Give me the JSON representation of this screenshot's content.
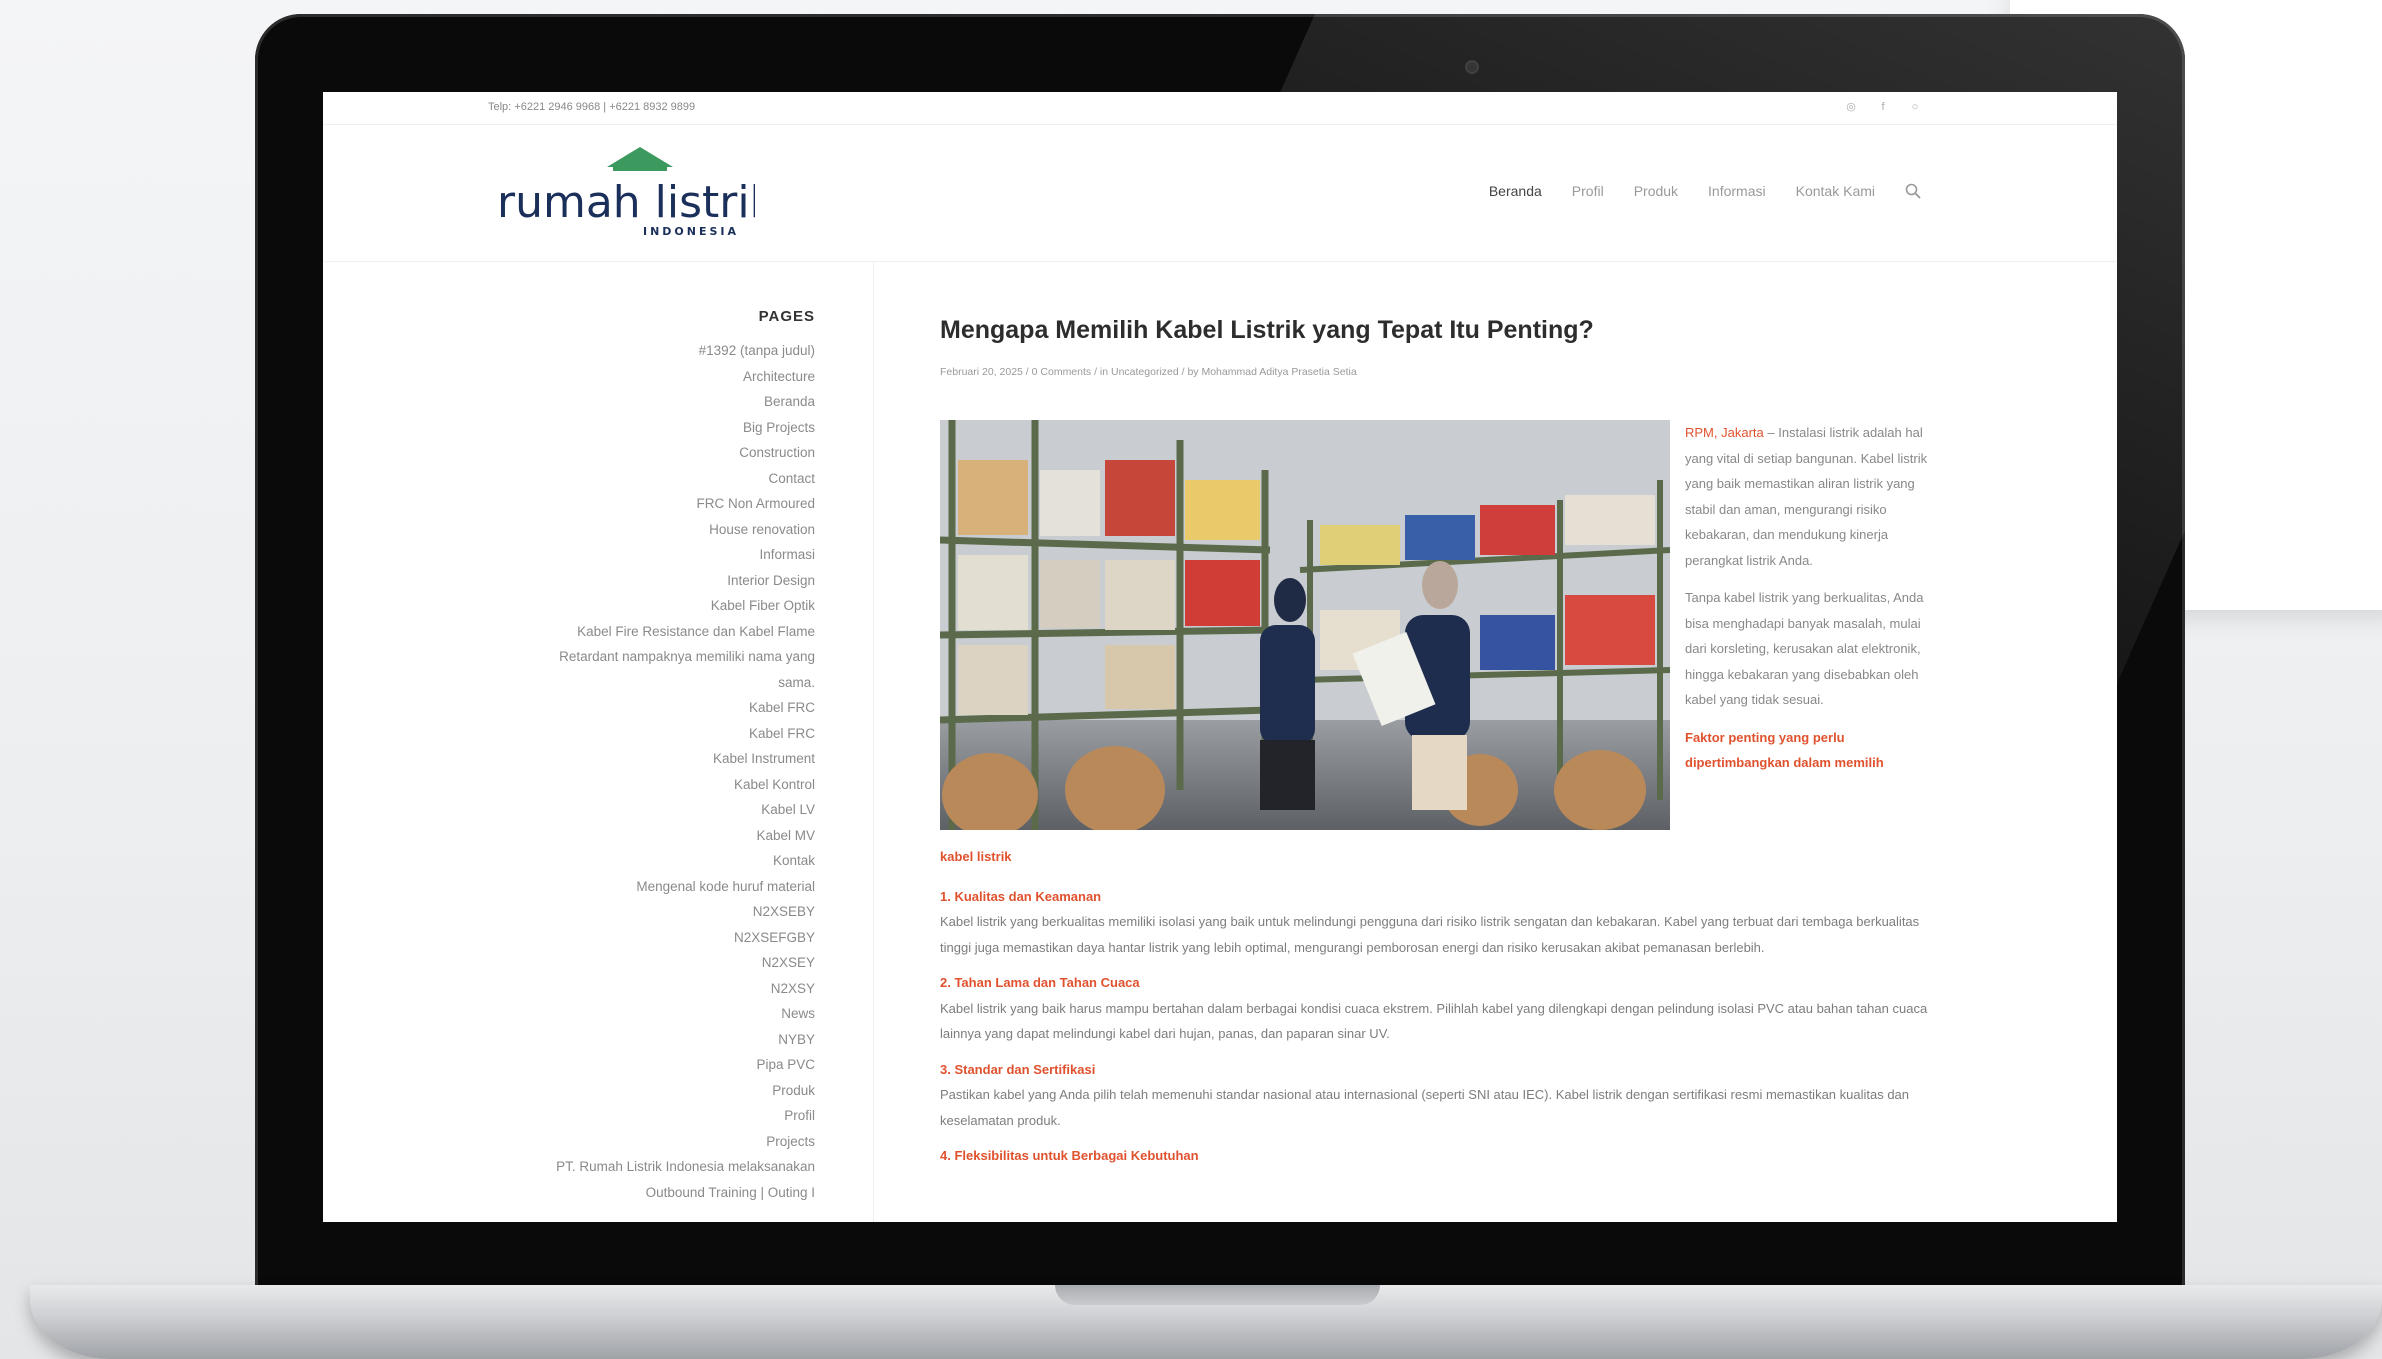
{
  "site": {
    "phone": "Telp: +6221 2946 9968 | +6221 8932 9899",
    "brand_line1": "rumah listrik",
    "brand_line2": "INDONESIA",
    "nav": [
      "Beranda",
      "Profil",
      "Produk",
      "Informasi",
      "Kontak Kami"
    ],
    "active_nav": "Beranda",
    "colors": {
      "accent": "#e0522e",
      "brand_green": "#3c9a5f",
      "brand_navy": "#1a2f5a"
    }
  },
  "sidebar": {
    "title": "PAGES",
    "items": [
      "#1392 (tanpa judul)",
      "Architecture",
      "Beranda",
      "Big Projects",
      "Construction",
      "Contact",
      "FRC Non Armoured",
      "House renovation",
      "Informasi",
      "Interior Design",
      "Kabel Fiber Optik",
      "Kabel Fire Resistance dan Kabel Flame",
      "Retardant nampaknya memiliki nama yang",
      "sama.",
      "Kabel FRC",
      "Kabel FRC",
      "Kabel Instrument",
      "Kabel Kontrol",
      "Kabel LV",
      "Kabel MV",
      "Kontak",
      "Mengenal kode huruf material",
      "N2XSEBY",
      "N2XSEFGBY",
      "N2XSEY",
      "N2XSY",
      "News",
      "NYBY",
      "Pipa PVC",
      "Produk",
      "Profil",
      "Projects",
      "PT. Rumah Listrik Indonesia melaksanakan",
      "Outbound Training | Outing I"
    ]
  },
  "article": {
    "title": "Mengapa Memilih Kabel Listrik yang Tepat Itu Penting?",
    "meta": "Februari 20, 2025  /  0 Comments  /  in Uncategorized  /  by Mohammad Aditya Prasetia Setia",
    "intro_location": "RPM, Jakarta",
    "intro_p1": " – Instalasi listrik adalah hal yang vital di setiap bangunan. Kabel listrik yang baik memastikan aliran listrik yang stabil dan aman, mengurangi risiko kebakaran, dan mendukung kinerja perangkat listrik Anda.",
    "intro_p2": "Tanpa kabel listrik yang berkualitas, Anda bisa menghadapi banyak masalah, mulai dari korsleting, kerusakan alat elektronik, hingga kebakaran yang disebabkan oleh kabel yang tidak sesuai.",
    "factors_heading_a": "Faktor penting yang perlu dipertimbangkan dalam memilih",
    "factors_heading_b": "kabel listrik",
    "sections": [
      {
        "title": "1. Kualitas dan Keamanan",
        "text": "Kabel listrik yang berkualitas memiliki isolasi yang baik untuk melindungi pengguna dari risiko listrik sengatan dan kebakaran. Kabel yang terbuat dari tembaga berkualitas tinggi juga memastikan daya hantar listrik yang lebih optimal, mengurangi pemborosan energi dan risiko kerusakan akibat pemanasan berlebih."
      },
      {
        "title": "2. Tahan Lama dan Tahan Cuaca",
        "text": "Kabel listrik yang baik harus mampu bertahan dalam berbagai kondisi cuaca ekstrem. Pilihlah kabel yang dilengkapi dengan pelindung isolasi PVC atau bahan tahan cuaca lainnya yang dapat melindungi kabel dari hujan, panas, dan paparan sinar UV."
      },
      {
        "title": "3. Standar dan Sertifikasi",
        "text": "Pastikan kabel yang Anda pilih telah memenuhi standar nasional atau internasional (seperti SNI atau IEC). Kabel listrik dengan sertifikasi resmi memastikan kualitas dan keselamatan produk."
      },
      {
        "title": "4. Fleksibilitas untuk Berbagai Kebutuhan",
        "text": ""
      }
    ]
  }
}
